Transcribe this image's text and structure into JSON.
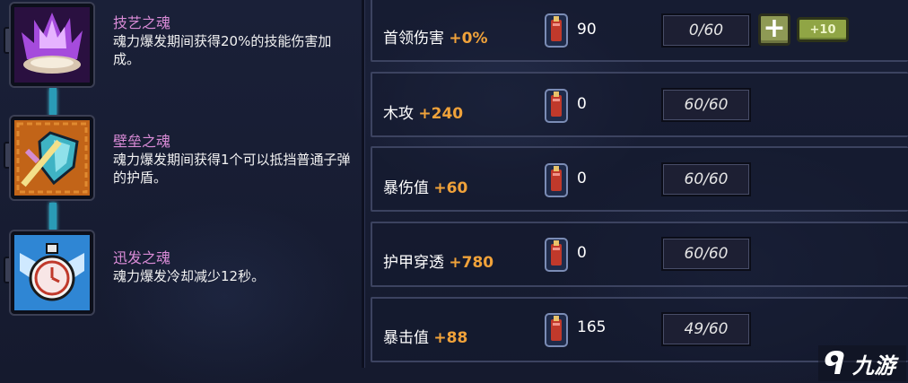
{
  "skills": [
    {
      "name": "技艺之魂",
      "desc": "魂力爆发期间获得20%的技能伤害加成。",
      "icon": "purple-crystal-icon"
    },
    {
      "name": "壁垒之魂",
      "desc": "魂力爆发期间获得1个可以抵挡普通子弹的护盾。",
      "icon": "shield-sword-icon"
    },
    {
      "name": "迅发之魂",
      "desc": "魂力爆发冷却减少12秒。",
      "icon": "stopwatch-icon"
    }
  ],
  "stats": [
    {
      "label": "首领伤害",
      "bonus": "+0%",
      "gems": "90",
      "level": "0/60"
    },
    {
      "label": "木攻",
      "bonus": "+240",
      "gems": "0",
      "level": "60/60"
    },
    {
      "label": "暴伤值",
      "bonus": "+60",
      "gems": "0",
      "level": "60/60"
    },
    {
      "label": "护甲穿透",
      "bonus": "+780",
      "gems": "0",
      "level": "60/60"
    },
    {
      "label": "暴击值",
      "bonus": "+88",
      "gems": "165",
      "level": "49/60"
    }
  ],
  "buttons": {
    "plus": "+",
    "plus10": "+10"
  },
  "watermark": {
    "text": "九游",
    "icon": "logo-icon"
  },
  "colors": {
    "accent_bonus": "#f0a23a",
    "skill_name": "#d98bd6",
    "connector": "#2a9bb6"
  }
}
